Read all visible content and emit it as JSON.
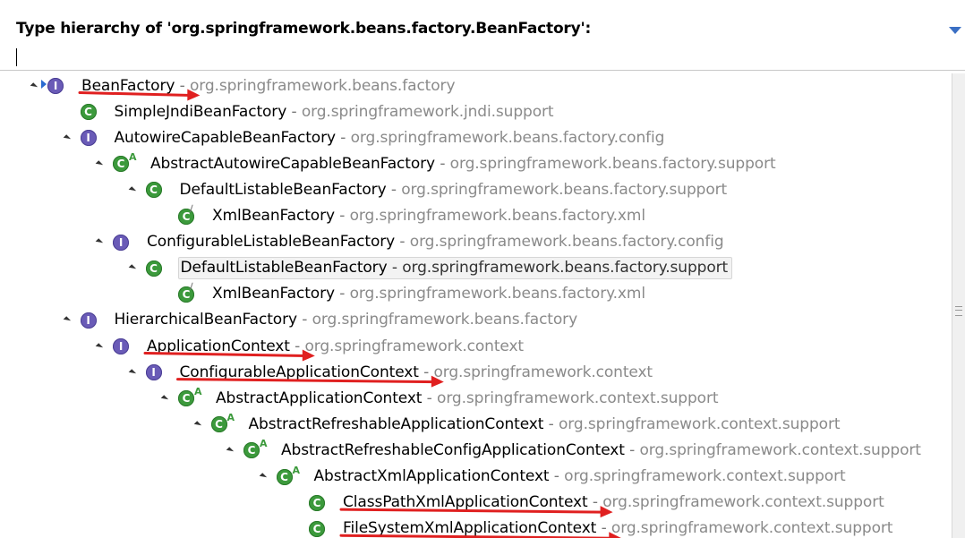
{
  "header": {
    "title": "Type hierarchy of 'org.springframework.beans.factory.BeanFactory':",
    "filter_value": ""
  },
  "colors": {
    "interface_icon": "#6a5bb7",
    "class_icon": "#3c9a3c",
    "annotation_arrow": "#e02020",
    "package_text": "#8a8a8a"
  },
  "tree": [
    {
      "name": "BeanFactory",
      "package": "org.springframework.beans.factory",
      "kind": "interface",
      "depth": 0,
      "expanded": true,
      "icon": "binary-interface-icon"
    },
    {
      "name": "SimpleJndiBeanFactory",
      "package": "org.springframework.jndi.support",
      "kind": "class",
      "depth": 1,
      "expanded": null
    },
    {
      "name": "AutowireCapableBeanFactory",
      "package": "org.springframework.beans.factory.config",
      "kind": "interface",
      "depth": 1,
      "expanded": true
    },
    {
      "name": "AbstractAutowireCapableBeanFactory",
      "package": "org.springframework.beans.factory.support",
      "kind": "class",
      "abstract": true,
      "depth": 2,
      "expanded": true
    },
    {
      "name": "DefaultListableBeanFactory",
      "package": "org.springframework.beans.factory.support",
      "kind": "class",
      "depth": 3,
      "expanded": true
    },
    {
      "name": "XmlBeanFactory",
      "package": "org.springframework.beans.factory.xml",
      "kind": "class",
      "deprecated": true,
      "depth": 4,
      "expanded": null
    },
    {
      "name": "ConfigurableListableBeanFactory",
      "package": "org.springframework.beans.factory.config",
      "kind": "interface",
      "depth": 2,
      "expanded": true
    },
    {
      "name": "DefaultListableBeanFactory",
      "package": "org.springframework.beans.factory.support",
      "kind": "class",
      "depth": 3,
      "expanded": true,
      "selected": true
    },
    {
      "name": "XmlBeanFactory",
      "package": "org.springframework.beans.factory.xml",
      "kind": "class",
      "deprecated": true,
      "depth": 4,
      "expanded": null
    },
    {
      "name": "HierarchicalBeanFactory",
      "package": "org.springframework.beans.factory",
      "kind": "interface",
      "depth": 1,
      "expanded": true
    },
    {
      "name": "ApplicationContext",
      "package": "org.springframework.context",
      "kind": "interface",
      "depth": 2,
      "expanded": true
    },
    {
      "name": "ConfigurableApplicationContext",
      "package": "org.springframework.context",
      "kind": "interface",
      "depth": 3,
      "expanded": true
    },
    {
      "name": "AbstractApplicationContext",
      "package": "org.springframework.context.support",
      "kind": "class",
      "abstract": true,
      "depth": 4,
      "expanded": true
    },
    {
      "name": "AbstractRefreshableApplicationContext",
      "package": "org.springframework.context.support",
      "kind": "class",
      "abstract": true,
      "depth": 5,
      "expanded": true
    },
    {
      "name": "AbstractRefreshableConfigApplicationContext",
      "package": "org.springframework.context.support",
      "kind": "class",
      "abstract": true,
      "depth": 6,
      "expanded": true
    },
    {
      "name": "AbstractXmlApplicationContext",
      "package": "org.springframework.context.support",
      "kind": "class",
      "abstract": true,
      "depth": 7,
      "expanded": true
    },
    {
      "name": "ClassPathXmlApplicationContext",
      "package": "org.springframework.context.support",
      "kind": "class",
      "depth": 8,
      "expanded": null
    },
    {
      "name": "FileSystemXmlApplicationContext",
      "package": "org.springframework.context.support",
      "kind": "class",
      "depth": 8,
      "expanded": null
    }
  ],
  "annotations": {
    "arrows_on_rows": [
      0,
      10,
      11,
      16,
      17
    ]
  }
}
